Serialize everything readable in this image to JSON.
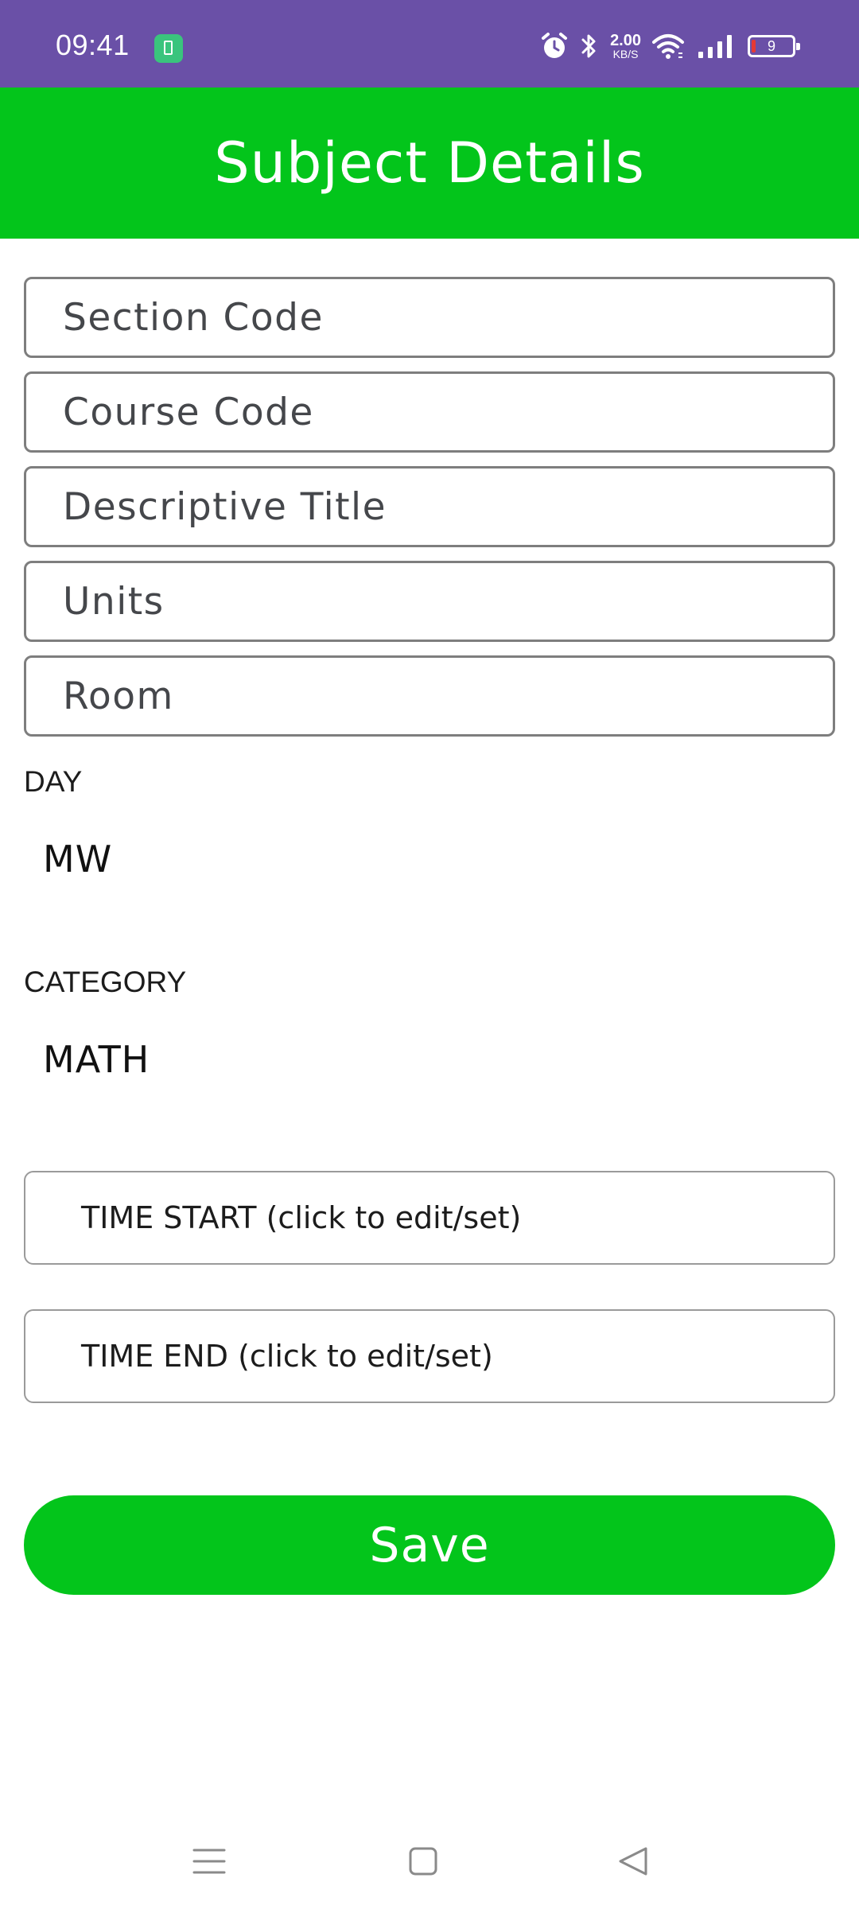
{
  "status_bar": {
    "time": "09:41",
    "net_speed_value": "2.00",
    "net_speed_unit": "KB/S",
    "battery_level": "9",
    "icons": [
      "app-notification-icon",
      "alarm-icon",
      "bluetooth-icon",
      "wifi-icon",
      "signal-icon",
      "battery-icon"
    ]
  },
  "header": {
    "title": "Subject Details"
  },
  "form": {
    "section_code_placeholder": "Section Code",
    "course_code_placeholder": "Course Code",
    "descriptive_title_placeholder": "Descriptive Title",
    "units_placeholder": "Units",
    "room_placeholder": "Room",
    "day_label": "DAY",
    "day_value": "MW",
    "category_label": "CATEGORY",
    "category_value": "MATH",
    "time_start_label": "TIME START (click to edit/set)",
    "time_end_label": "TIME END (click to edit/set)",
    "save_label": "Save"
  },
  "nav_bar": {
    "icons": [
      "menu-icon",
      "home-square-icon",
      "back-triangle-icon"
    ]
  },
  "colors": {
    "status_bar": "#6a50a7",
    "accent_green": "#03c51b",
    "field_border": "#7e7e7e",
    "text": "#45474b"
  }
}
